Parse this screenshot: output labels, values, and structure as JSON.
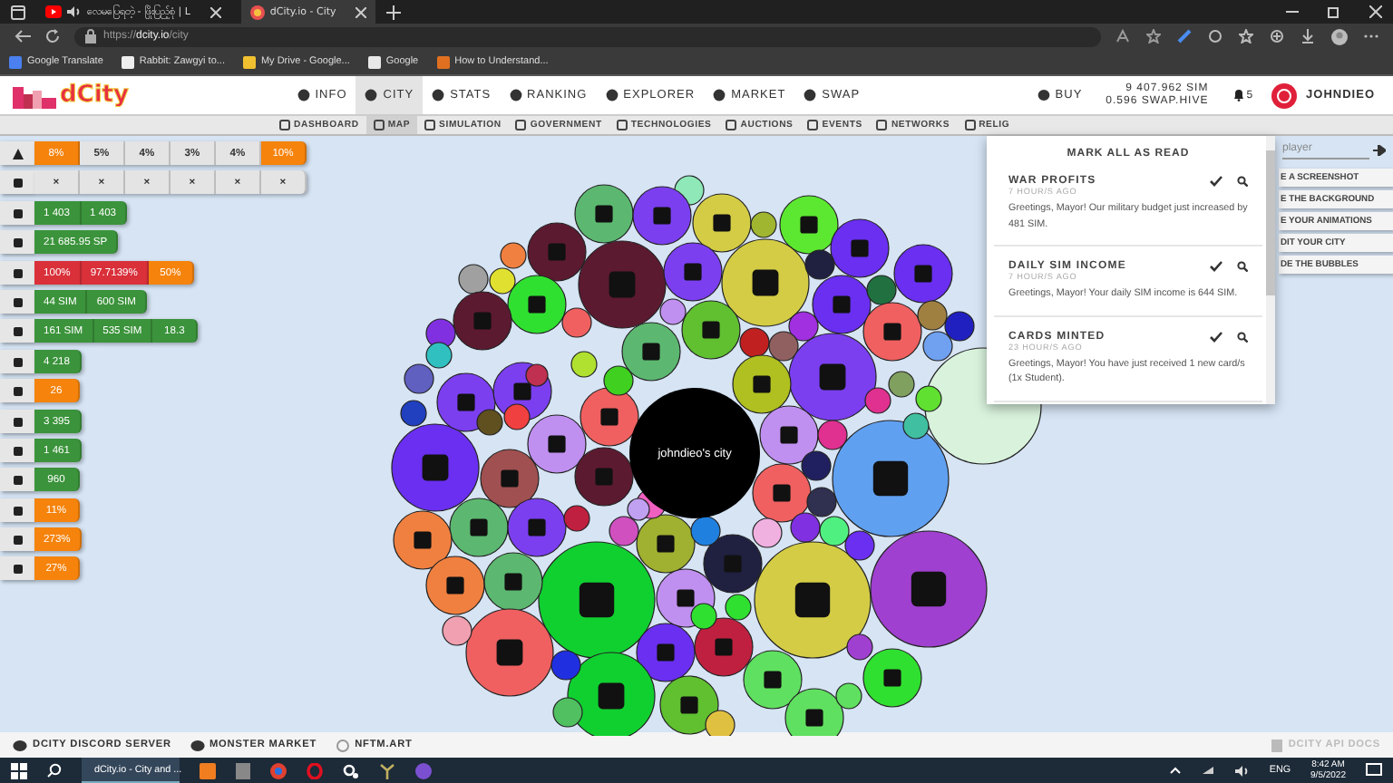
{
  "browser": {
    "tabs": [
      {
        "title": "လေမပြေရတဲ့ - ဖြိုးပြည့်စုံ | L",
        "selected": false,
        "kind": "video"
      },
      {
        "title": "dCity.io - City",
        "selected": true,
        "kind": "site"
      }
    ],
    "url": {
      "scheme": "https://",
      "host": "dcity.io",
      "path": "/city"
    },
    "bookmarks": [
      "Google Translate",
      "Rabbit: Zawgyi to...",
      "My Drive - Google...",
      "Google",
      "How to Understand..."
    ]
  },
  "header": {
    "logo": "dCity",
    "nav": [
      {
        "label": "INFO",
        "selected": false
      },
      {
        "label": "CITY",
        "selected": true
      },
      {
        "label": "STATS",
        "selected": false
      },
      {
        "label": "RANKING",
        "selected": false
      },
      {
        "label": "EXPLORER",
        "selected": false
      },
      {
        "label": "MARKET",
        "selected": false
      },
      {
        "label": "SWAP",
        "selected": false
      }
    ],
    "buy": "BUY",
    "balances": [
      "9 407.962 SIM",
      "0.596 SWAP.HIVE"
    ],
    "notifications": "5",
    "user": "JOHNDIEO"
  },
  "subnav": [
    {
      "label": "DASHBOARD",
      "selected": false
    },
    {
      "label": "MAP",
      "selected": true
    },
    {
      "label": "SIMULATION",
      "selected": false
    },
    {
      "label": "GOVERNMENT",
      "selected": false
    },
    {
      "label": "TECHNOLOGIES",
      "selected": false
    },
    {
      "label": "AUCTIONS",
      "selected": false
    },
    {
      "label": "EVENTS",
      "selected": false
    },
    {
      "label": "NETWORKS",
      "selected": false
    },
    {
      "label": "RELIG",
      "selected": false
    }
  ],
  "stats": [
    [
      {
        "cells": [
          {
            "text": "8%",
            "color": "#f5830c"
          },
          {
            "text": "5%",
            "color": "#e4e4e4"
          },
          {
            "text": "4%",
            "color": "#e4e4e4"
          },
          {
            "text": "3%",
            "color": "#e4e4e4"
          },
          {
            "text": "4%",
            "color": "#e4e4e4"
          },
          {
            "text": "10%",
            "color": "#f5830c"
          }
        ]
      },
      {
        "cells": [
          {
            "text": "×",
            "color": "#e4e4e4"
          },
          {
            "text": "×",
            "color": "#e4e4e4"
          },
          {
            "text": "×",
            "color": "#e4e4e4"
          },
          {
            "text": "×",
            "color": "#e4e4e4"
          },
          {
            "text": "×",
            "color": "#e4e4e4"
          },
          {
            "text": "×",
            "color": "#e4e4e4"
          }
        ]
      }
    ],
    [
      {
        "cells": [
          {
            "text": "1 403",
            "color": "#3b933b"
          },
          {
            "text": "1 403",
            "color": "#3b933b"
          }
        ]
      },
      {
        "cells": [
          {
            "text": "21 685.95 SP",
            "color": "#3b933b"
          }
        ]
      }
    ],
    [
      {
        "cells": [
          {
            "text": "100%",
            "color": "#d9303a"
          },
          {
            "text": "97.7139%",
            "color": "#d9303a"
          },
          {
            "text": "50%",
            "color": "#f5830c"
          }
        ]
      },
      {
        "cells": [
          {
            "text": "44 SIM",
            "color": "#3b933b"
          },
          {
            "text": "600 SIM",
            "color": "#3b933b"
          }
        ]
      },
      {
        "cells": [
          {
            "text": "161 SIM",
            "color": "#3b933b"
          },
          {
            "text": "535 SIM",
            "color": "#3b933b"
          },
          {
            "text": "18.3",
            "color": "#3b933b"
          }
        ]
      }
    ],
    [
      {
        "cells": [
          {
            "text": "4 218",
            "color": "#3b933b"
          }
        ]
      },
      {
        "cells": [
          {
            "text": "26",
            "color": "#f5830c"
          }
        ]
      }
    ],
    [
      {
        "cells": [
          {
            "text": "3 395",
            "color": "#3b933b"
          }
        ]
      },
      {
        "cells": [
          {
            "text": "1 461",
            "color": "#3b933b"
          }
        ]
      },
      {
        "cells": [
          {
            "text": "960",
            "color": "#3b933b"
          }
        ]
      }
    ],
    [
      {
        "cells": [
          {
            "text": "11%",
            "color": "#f5830c"
          }
        ]
      },
      {
        "cells": [
          {
            "text": "273%",
            "color": "#f5830c"
          }
        ]
      },
      {
        "cells": [
          {
            "text": "27%",
            "color": "#f5830c"
          }
        ]
      }
    ]
  ],
  "map": {
    "city_name": "johndieo's city"
  },
  "tools": {
    "search_placeholder": "player",
    "buttons": [
      "E A SCREENSHOT",
      "E THE BACKGROUND",
      "E YOUR ANIMATIONS",
      "DIT YOUR CITY",
      "DE THE BUBBLES"
    ]
  },
  "notifications_menu": {
    "mark_all": "MARK ALL AS READ",
    "items": [
      {
        "title": "WAR PROFITS",
        "time": "7 HOUR/S AGO",
        "text": "Greetings, Mayor! Our military budget just increased by 481 SIM."
      },
      {
        "title": "DAILY SIM INCOME",
        "time": "7 HOUR/S AGO",
        "text": "Greetings, Mayor! Your daily SIM income is 644 SIM."
      },
      {
        "title": "CARDS MINTED",
        "time": "23 HOUR/S AGO",
        "text": "Greetings, Mayor! You have just received 1 new card/s (1x Student)."
      }
    ]
  },
  "footer": {
    "links": [
      "DCITY DISCORD SERVER",
      "MONSTER MARKET",
      "NFTM.ART"
    ],
    "api_docs": "DCITY API DOCS"
  },
  "taskbar": {
    "active_app": "dCity.io - City and ...",
    "language": "ENG",
    "time": "8:42 AM",
    "date": "9/5/2022"
  }
}
